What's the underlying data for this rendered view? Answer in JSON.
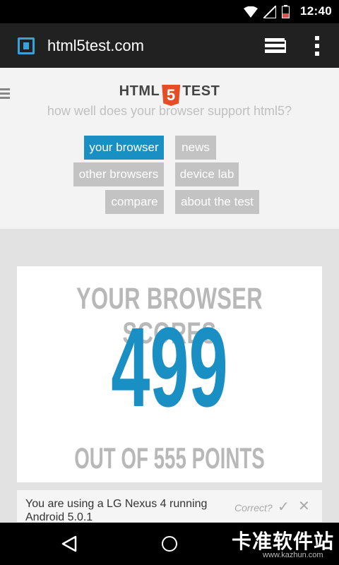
{
  "status_bar": {
    "time": "12:40"
  },
  "browser": {
    "url": "html5test.com"
  },
  "site": {
    "logo_left": "HTML",
    "logo_badge": "5",
    "logo_right": "TEST",
    "tagline": "how well does your browser support html5?",
    "nav": {
      "your_browser": "your browser",
      "news": "news",
      "other_browsers": "other browsers",
      "device_lab": "device lab",
      "compare": "compare",
      "about": "about the test"
    }
  },
  "score": {
    "heading": "YOUR BROWSER SCORES",
    "value": "499",
    "footer": "OUT OF 555 POINTS"
  },
  "device_banner": {
    "text": "You are using a LG Nexus 4 running Android 5.0.1",
    "correct_label": "Correct?",
    "confirm_glyph": "✓",
    "dismiss_glyph": "✕"
  },
  "watermark": {
    "text": "卡准软件站",
    "sub": "www.kazhun.com"
  },
  "colors": {
    "accent": "#1a8fc4",
    "html5_orange": "#e44d26",
    "button_gray": "#c3c3c3"
  }
}
